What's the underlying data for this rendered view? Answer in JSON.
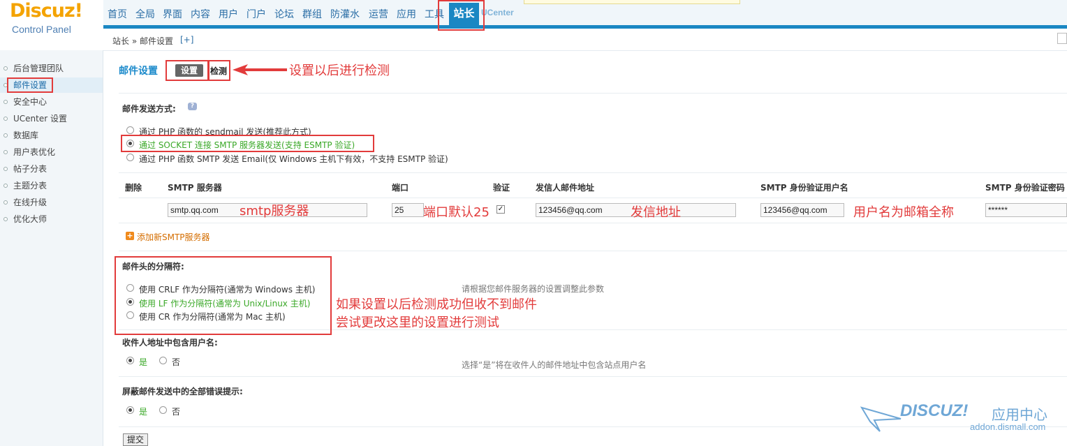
{
  "app": {
    "logo": "Discuz!",
    "logo_sub": "Control Panel"
  },
  "topnav": {
    "items": [
      "首页",
      "全局",
      "界面",
      "内容",
      "用户",
      "门户",
      "论坛",
      "群组",
      "防灌水",
      "运营",
      "应用",
      "工具"
    ],
    "active": "站长",
    "ucenter": "UCenter"
  },
  "sidebar": {
    "items": [
      "后台管理团队",
      "邮件设置",
      "安全中心",
      "UCenter 设置",
      "数据库",
      "用户表优化",
      "帖子分表",
      "主题分表",
      "在线升级",
      "优化大师"
    ],
    "active_index": 1
  },
  "breadcrumb": {
    "text": "站长 » 邮件设置",
    "plus": "[+]"
  },
  "page": {
    "title": "邮件设置",
    "tabs": [
      "设置",
      "检测"
    ],
    "send_method": {
      "label": "邮件发送方式:",
      "options": [
        "通过 PHP 函数的 sendmail 发送(推荐此方式)",
        "通过 SOCKET 连接 SMTP 服务器发送(支持 ESMTP 验证)",
        "通过 PHP 函数 SMTP 发送 Email(仅 Windows 主机下有效，不支持 ESMTP 验证)"
      ],
      "selected": 1
    },
    "smtp_table": {
      "headers": [
        "删除",
        "SMTP 服务器",
        "端口",
        "验证",
        "发信人邮件地址",
        "SMTP 身份验证用户名",
        "SMTP 身份验证密码"
      ],
      "row": {
        "server": "smtp.qq.com",
        "port": "25",
        "auth": true,
        "from": "123456@qq.com",
        "user": "123456@qq.com",
        "password": "******"
      },
      "add_label": "添加新SMTP服务器"
    },
    "delimiter": {
      "label": "邮件头的分隔符:",
      "options": [
        "使用 CRLF 作为分隔符(通常为 Windows 主机)",
        "使用 LF 作为分隔符(通常为 Unix/Linux 主机)",
        "使用 CR 作为分隔符(通常为 Mac 主机)"
      ],
      "selected": 1,
      "tip": "请根据您邮件服务器的设置调整此参数"
    },
    "include_username": {
      "label": "收件人地址中包含用户名:",
      "yes": "是",
      "no": "否",
      "tip": "选择“是”将在收件人的邮件地址中包含站点用户名"
    },
    "silent": {
      "label": "屏蔽邮件发送中的全部错误提示:",
      "yes": "是",
      "no": "否"
    },
    "submit": "提交"
  },
  "annotations": {
    "check_after": "设置以后进行检测",
    "smtp_server": "smtp服务器",
    "port_default": "端口默认25",
    "sender": "发信地址",
    "username_full": "用户名为邮箱全称",
    "delimiter_line1": "如果设置以后检测成功但收不到邮件",
    "delimiter_line2": "尝试更改这里的设置进行测试"
  },
  "watermark": {
    "logo": "DISCUZ!",
    "cn": "应用中心",
    "url": "addon.dismall.com"
  }
}
